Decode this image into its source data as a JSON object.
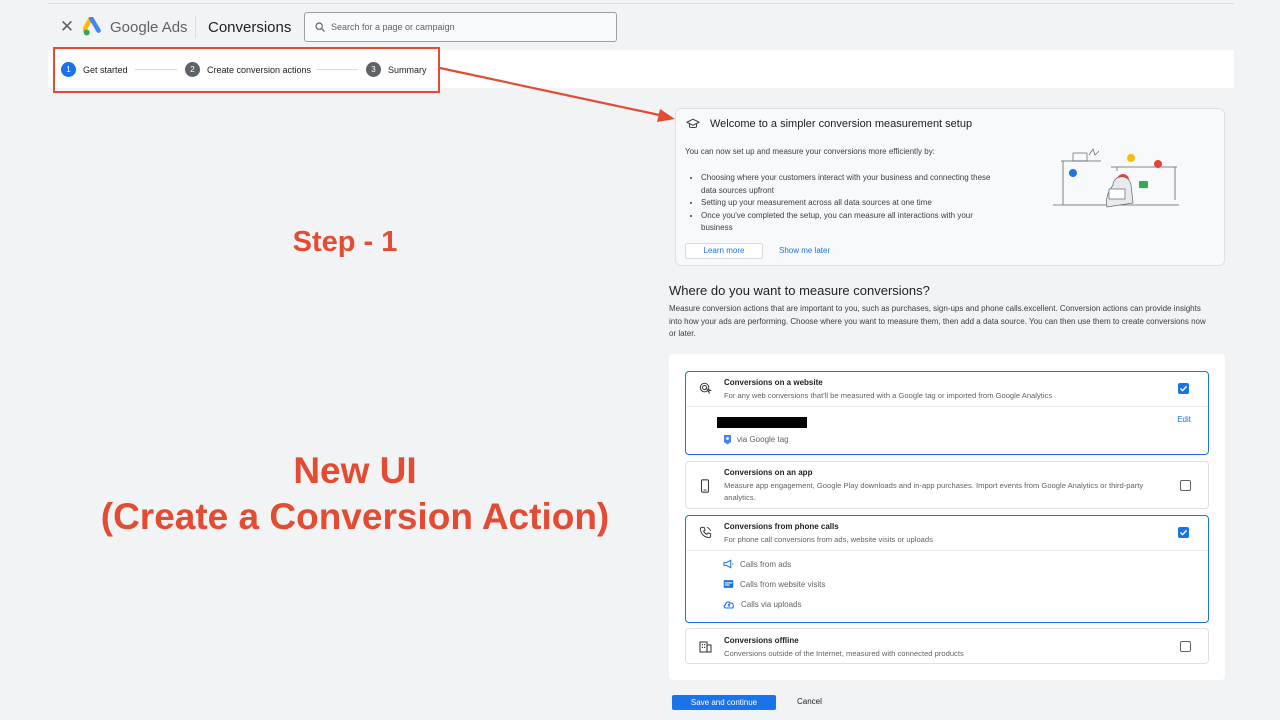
{
  "header": {
    "brand": "Google Ads",
    "section": "Conversions",
    "search_placeholder": "Search for a page or campaign"
  },
  "stepper": {
    "steps": [
      {
        "num": "1",
        "label": "Get started"
      },
      {
        "num": "2",
        "label": "Create conversion actions"
      },
      {
        "num": "3",
        "label": "Summary"
      }
    ]
  },
  "annotations": {
    "step": "Step - 1",
    "ui_line1": "New UI",
    "ui_line2": "(Create a Conversion Action)"
  },
  "welcome": {
    "title": "Welcome to a simpler conversion measurement setup",
    "intro": "You can now set up and measure your conversions more efficiently by:",
    "bullets": [
      "Choosing where your customers interact with your business and connecting these data sources upfront",
      "Setting up your measurement across all data sources at one time",
      "Once you've completed the setup, you can measure all interactions with your business"
    ],
    "learn_more": "Learn more",
    "show_later": "Show me later"
  },
  "where": {
    "title": "Where do you want to measure conversions?",
    "description": "Measure conversion actions that are important to you, such as purchases, sign-ups and phone calls.excellent. Conversion actions can provide insights into how your ads are performing. Choose where you want to measure them, then add a data source. You can then use them to create conversions now or later."
  },
  "options": {
    "website": {
      "title": "Conversions on a website",
      "subtitle": "For any web conversions that'll be measured with a Google tag or imported from Google Analytics",
      "checked": true,
      "edit": "Edit",
      "via": "via Google tag"
    },
    "app": {
      "title": "Conversions on an app",
      "subtitle": "Measure app engagement, Google Play downloads and in-app purchases. Import events from Google Analytics or third-party analytics.",
      "checked": false
    },
    "phone": {
      "title": "Conversions from phone calls",
      "subtitle": "For phone call conversions from ads, website visits or uploads",
      "checked": true,
      "items": [
        "Calls from ads",
        "Calls from website visits",
        "Calls via uploads"
      ]
    },
    "offline": {
      "title": "Conversions offline",
      "subtitle": "Conversions outside of the Internet, measured with connected products",
      "checked": false
    }
  },
  "actions": {
    "save": "Save and continue",
    "cancel": "Cancel"
  },
  "colors": {
    "accent": "#1a73e8",
    "annotation": "#e34b32"
  }
}
